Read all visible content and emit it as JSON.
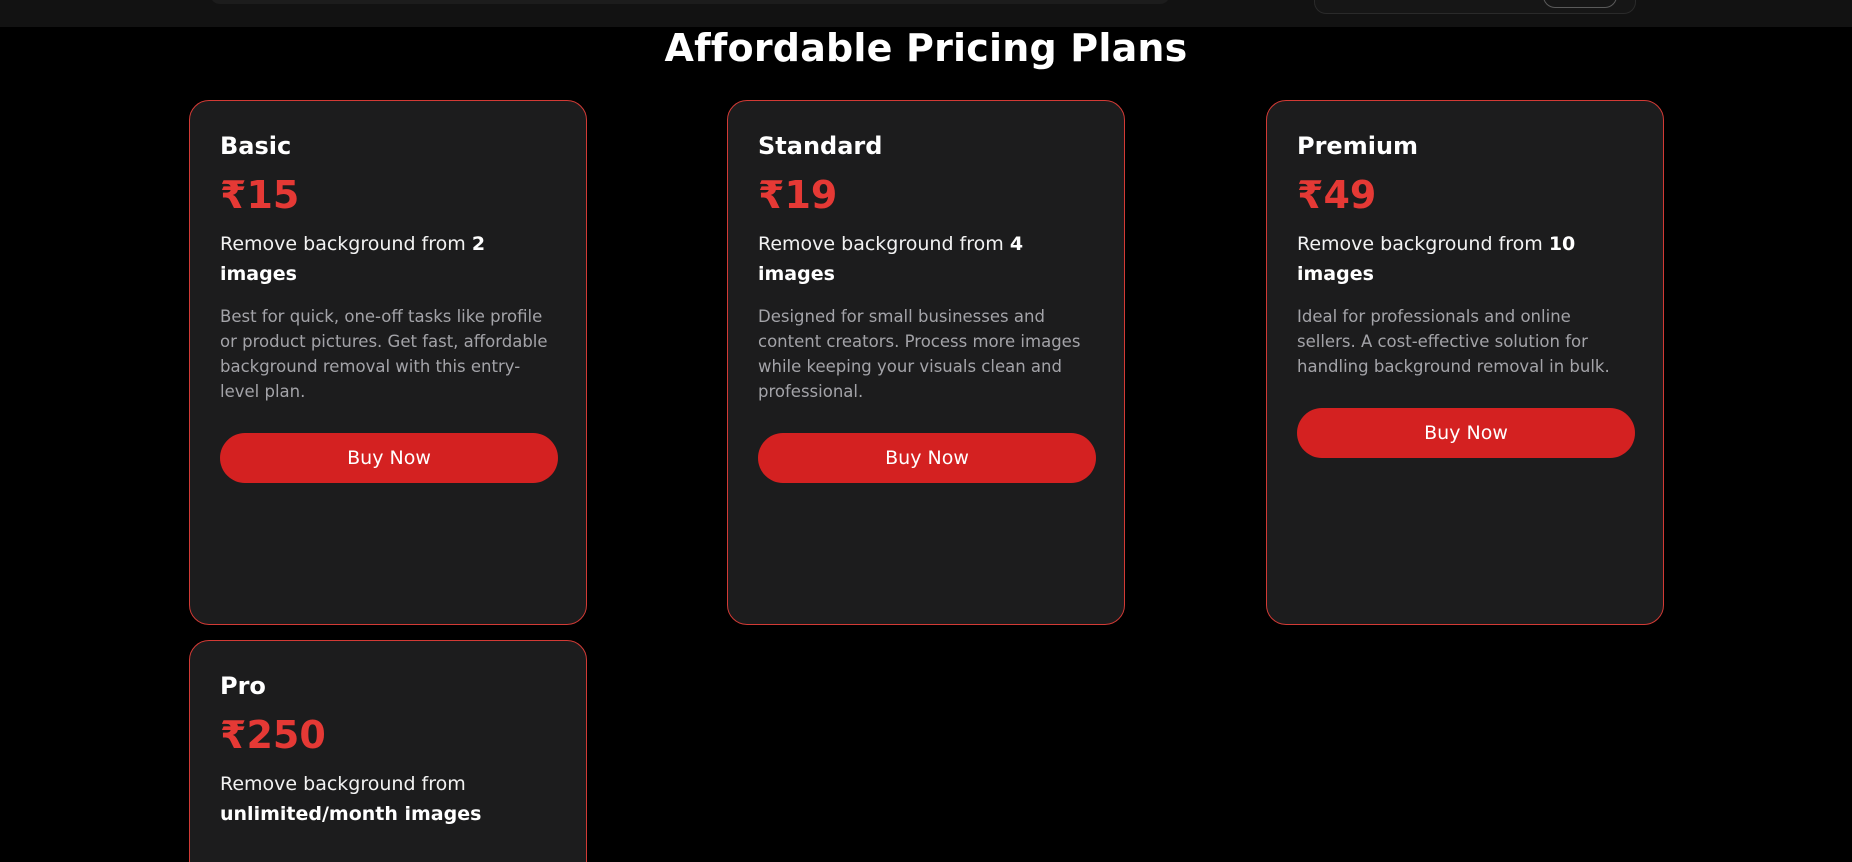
{
  "colors": {
    "background": "#000000",
    "card_background": "#1c1c1d",
    "card_border": "#d23a35",
    "accent": "#e53935",
    "button": "#d42121",
    "muted_text": "#a3a3a8"
  },
  "section": {
    "title": "Affordable Pricing Plans"
  },
  "plans": [
    {
      "name": "Basic",
      "price": "₹15",
      "feature_prefix": "Remove background from ",
      "feature_bold": "2 images",
      "description": "Best for quick, one-off tasks like profile or product pictures. Get fast, affordable background removal with this entry-level plan.",
      "button_label": "Buy Now"
    },
    {
      "name": "Standard",
      "price": "₹19",
      "feature_prefix": "Remove background from ",
      "feature_bold": "4 images",
      "description": "Designed for small businesses and content creators. Process more images while keeping your visuals clean and professional.",
      "button_label": "Buy Now"
    },
    {
      "name": "Premium",
      "price": "₹49",
      "feature_prefix": "Remove background from ",
      "feature_bold": "10 images",
      "description": "Ideal for professionals and online sellers. A cost-effective solution for handling background removal in bulk.",
      "button_label": "Buy Now"
    },
    {
      "name": "Pro",
      "price": "₹250",
      "feature_prefix": "Remove background from ",
      "feature_bold": "unlimited/month images"
    }
  ]
}
